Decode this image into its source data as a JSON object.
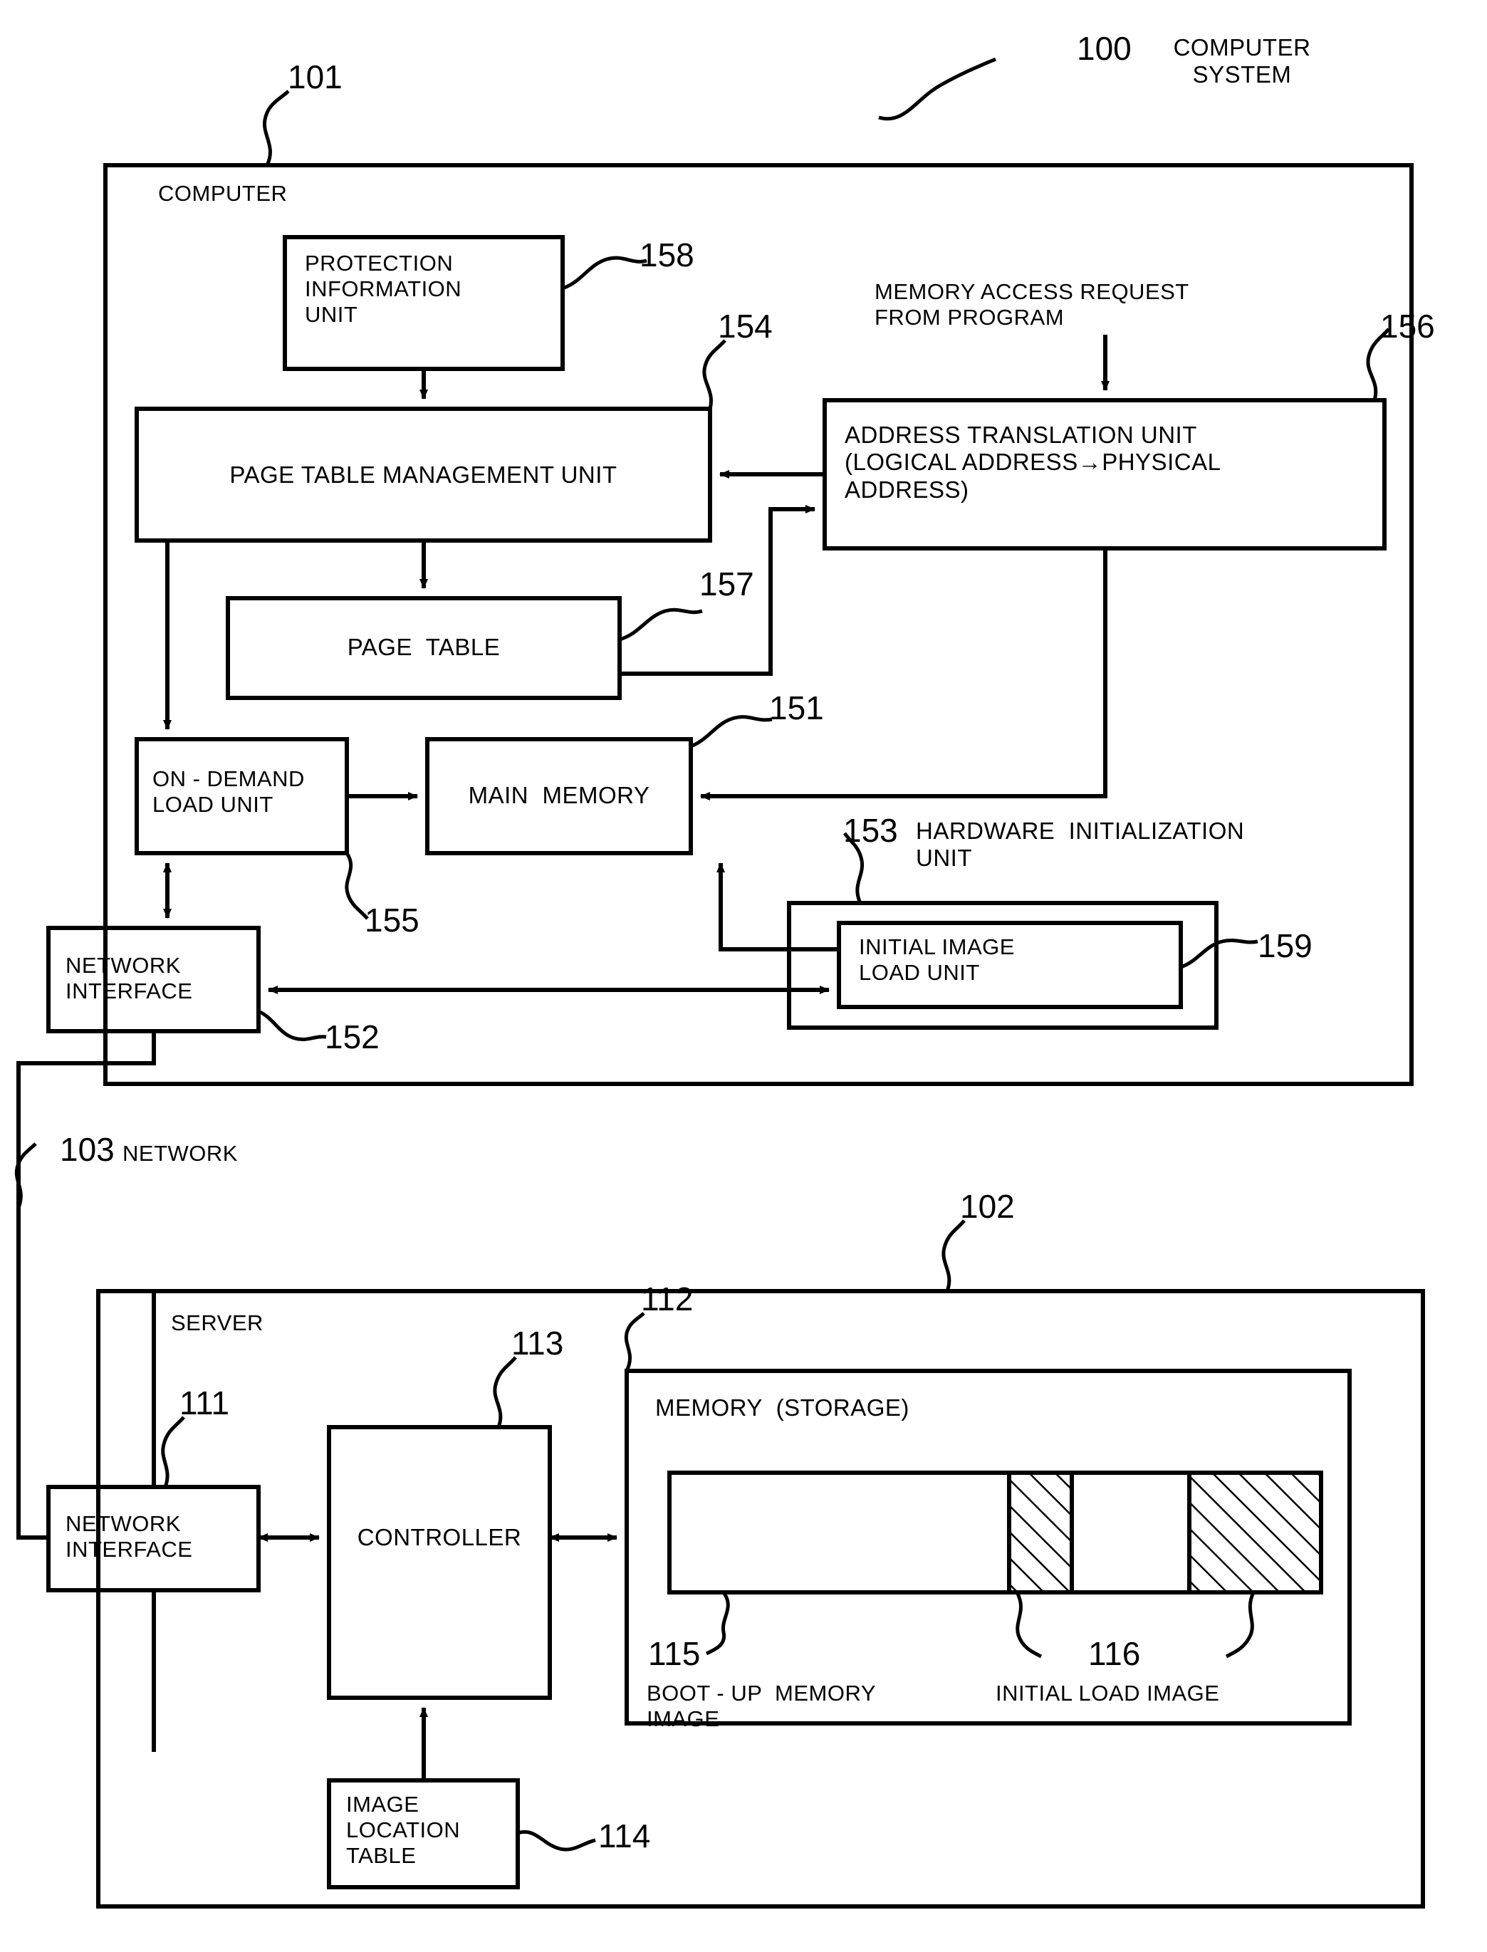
{
  "figure": {
    "system_label": {
      "ref": "100",
      "text": "COMPUTER\nSYSTEM"
    },
    "computer_ref": "101",
    "computer_title": "COMPUTER",
    "network_ref": "103",
    "network_label": "NETWORK",
    "server_ref": "102",
    "server_title": "SERVER"
  },
  "computer": {
    "protection_information_unit": {
      "ref": "158",
      "label": "PROTECTION\nINFORMATION\nUNIT"
    },
    "page_table_management_unit": {
      "ref": "154",
      "label": "PAGE TABLE MANAGEMENT UNIT"
    },
    "page_table": {
      "ref": "157",
      "label": "PAGE  TABLE"
    },
    "memory_access_request": {
      "label": "MEMORY ACCESS REQUEST\nFROM PROGRAM"
    },
    "address_translation_unit": {
      "ref": "156",
      "label": "ADDRESS TRANSLATION UNIT\n(LOGICAL ADDRESS→PHYSICAL\nADDRESS)"
    },
    "on_demand_load_unit": {
      "ref": "155",
      "label": "ON - DEMAND\nLOAD UNIT"
    },
    "main_memory": {
      "ref": "151",
      "label": "MAIN  MEMORY"
    },
    "hardware_initialization_unit": {
      "ref": "153",
      "label": "HARDWARE  INITIALIZATION\nUNIT"
    },
    "initial_image_load_unit": {
      "ref": "159",
      "label": "INITIAL IMAGE\nLOAD UNIT"
    },
    "network_interface": {
      "ref": "152",
      "label": "NETWORK\nINTERFACE"
    }
  },
  "server": {
    "network_interface": {
      "ref": "111",
      "label": "NETWORK\nINTERFACE"
    },
    "controller": {
      "ref": "113",
      "label": "CONTROLLER"
    },
    "image_location_table": {
      "ref": "114",
      "label": "IMAGE\nLOCATION\nTABLE"
    },
    "memory_storage": {
      "ref": "112",
      "label": "MEMORY  (STORAGE)"
    },
    "boot_up_memory_image": {
      "ref": "115",
      "label": "BOOT - UP  MEMORY\nIMAGE"
    },
    "initial_load_image": {
      "ref": "116",
      "label": "INITIAL LOAD IMAGE"
    }
  },
  "colors": {
    "ink": "#000000",
    "paper": "#ffffff"
  }
}
